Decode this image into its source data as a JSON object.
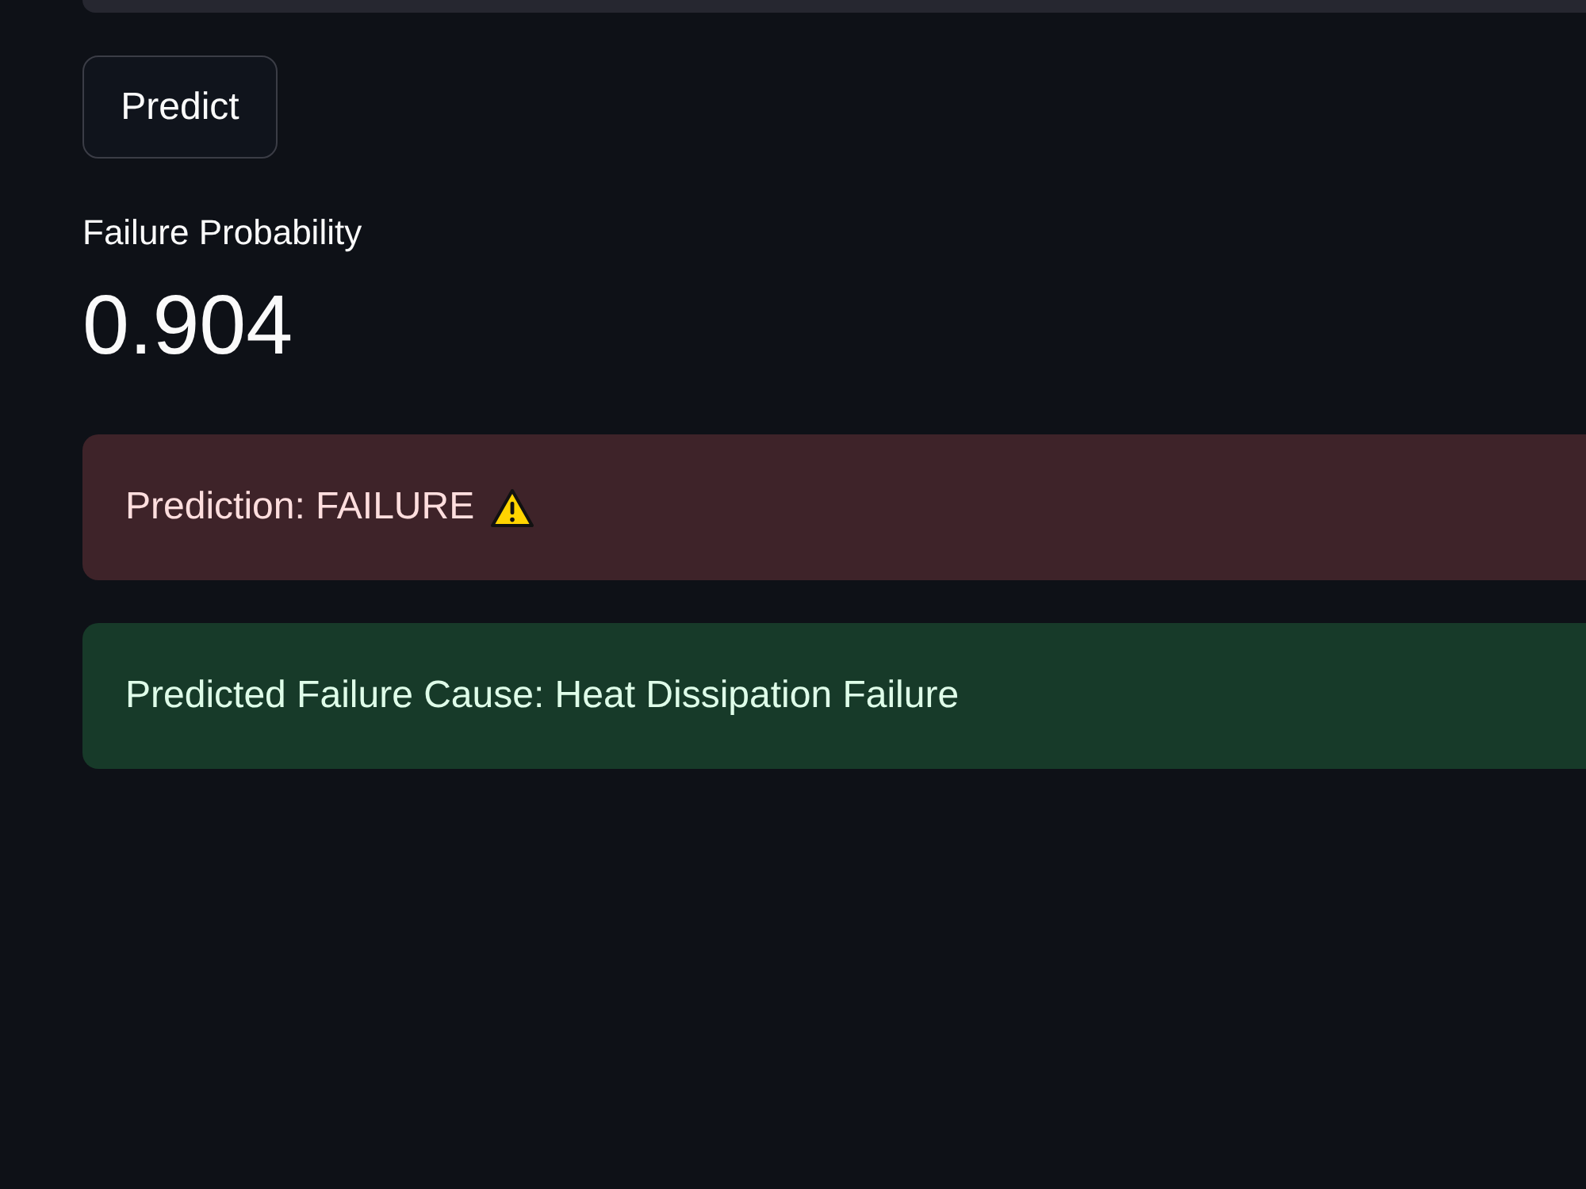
{
  "button": {
    "label": "Predict"
  },
  "metric": {
    "label": "Failure Probability",
    "value": "0.904"
  },
  "alerts": [
    {
      "kind": "error",
      "text": "Prediction: FAILURE",
      "warning_icon": true
    },
    {
      "kind": "success",
      "text": "Predicted Failure Cause: Heat Dissipation Failure"
    }
  ]
}
